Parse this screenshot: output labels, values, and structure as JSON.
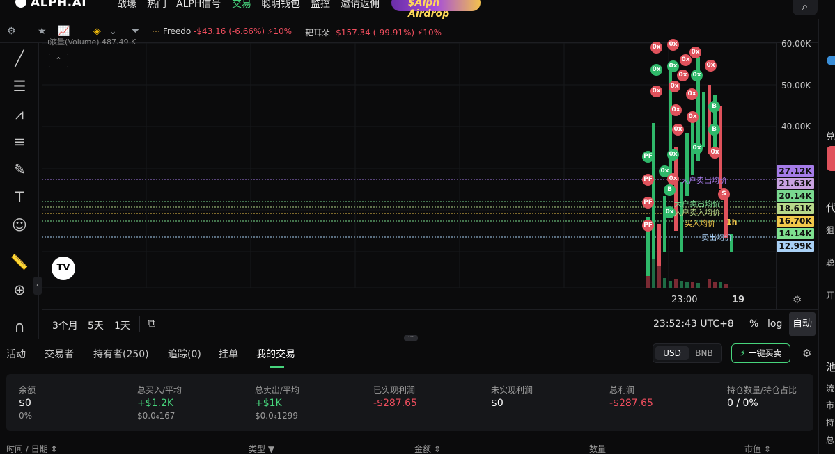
{
  "topnav": {
    "brand": "ALPH.AI",
    "items": [
      "战壕",
      "热门",
      "ALPH信号",
      "交易",
      "聪明钱包",
      "监控",
      "邀请返佣"
    ],
    "active_item": "交易",
    "airdrop_label": "$Alph Airdrop",
    "search_icon": "search-icon"
  },
  "tickers": [
    {
      "name": "Freedo",
      "change": "-$43.16 (-6.66%)",
      "badge": "10%"
    },
    {
      "name": "耙耳朵",
      "change": "-$157.34 (-99.91%)",
      "badge": "10%"
    }
  ],
  "chart": {
    "y_ticks": [
      "60.00K",
      "50.00K",
      "40.00K"
    ],
    "price_tags": [
      {
        "value": "27.12K",
        "color": "#a57be8"
      },
      {
        "value": "21.63K",
        "color": "#c8a2e0"
      },
      {
        "value": "20.14K",
        "color": "#79d98f"
      },
      {
        "value": "18.61K",
        "color": "#b7d98a"
      },
      {
        "value": "16.70K",
        "color": "#f2c84b"
      },
      {
        "value": "14.14K",
        "color": "#7ee08f"
      },
      {
        "value": "12.99K",
        "color": "#a9d0f5"
      }
    ],
    "line_labels": [
      "大户卖出均价",
      "大户卖出均价",
      "大户卖入均价",
      "买入均价",
      "1h",
      "卖出均价"
    ],
    "x_ticks": [
      "23:00",
      "19"
    ],
    "top_clipped_text": "ı液量(Volume)  487.49 K"
  },
  "controls": {
    "ranges": [
      "3个月",
      "5天",
      "1天"
    ],
    "clock": "23:52:43 UTC+8",
    "percent": "%",
    "log": "log",
    "auto": "自动"
  },
  "tabs": [
    "活动",
    "交易者",
    "持有者(250)",
    "追踪(0)",
    "挂单",
    "我的交易"
  ],
  "active_tab": "我的交易",
  "currency": {
    "options": [
      "USD",
      "BNB"
    ],
    "selected": "USD"
  },
  "quick_buy_label": "一键买卖",
  "stats": [
    {
      "label": "余额",
      "value": "$0",
      "sub": "0%",
      "tone": "neutral"
    },
    {
      "label": "总买入/平均",
      "value": "+$1.2K",
      "sub": "$0.0₄167",
      "tone": "up"
    },
    {
      "label": "总卖出/平均",
      "value": "+$1K",
      "sub": "$0.0₄1299",
      "tone": "up"
    },
    {
      "label": "已实现利润",
      "value": "-$287.65",
      "sub": "",
      "tone": "down"
    },
    {
      "label": "未实现利润",
      "value": "$0",
      "sub": "",
      "tone": "neutral"
    },
    {
      "label": "总利润",
      "value": "-$287.65",
      "sub": "",
      "tone": "down"
    },
    {
      "label": "持仓数量/持仓占比",
      "value": "0 / 0%",
      "sub": "",
      "tone": "neutral"
    }
  ],
  "table_headers": [
    "时间 / 日期 ⇕",
    "类型 ▼",
    "金额 ⇕",
    "数量",
    "市值 ⇕"
  ],
  "right_edge": [
    "兑",
    "代",
    "狙",
    "聪",
    "开",
    "池",
    "流",
    "市",
    "持",
    "总"
  ]
}
